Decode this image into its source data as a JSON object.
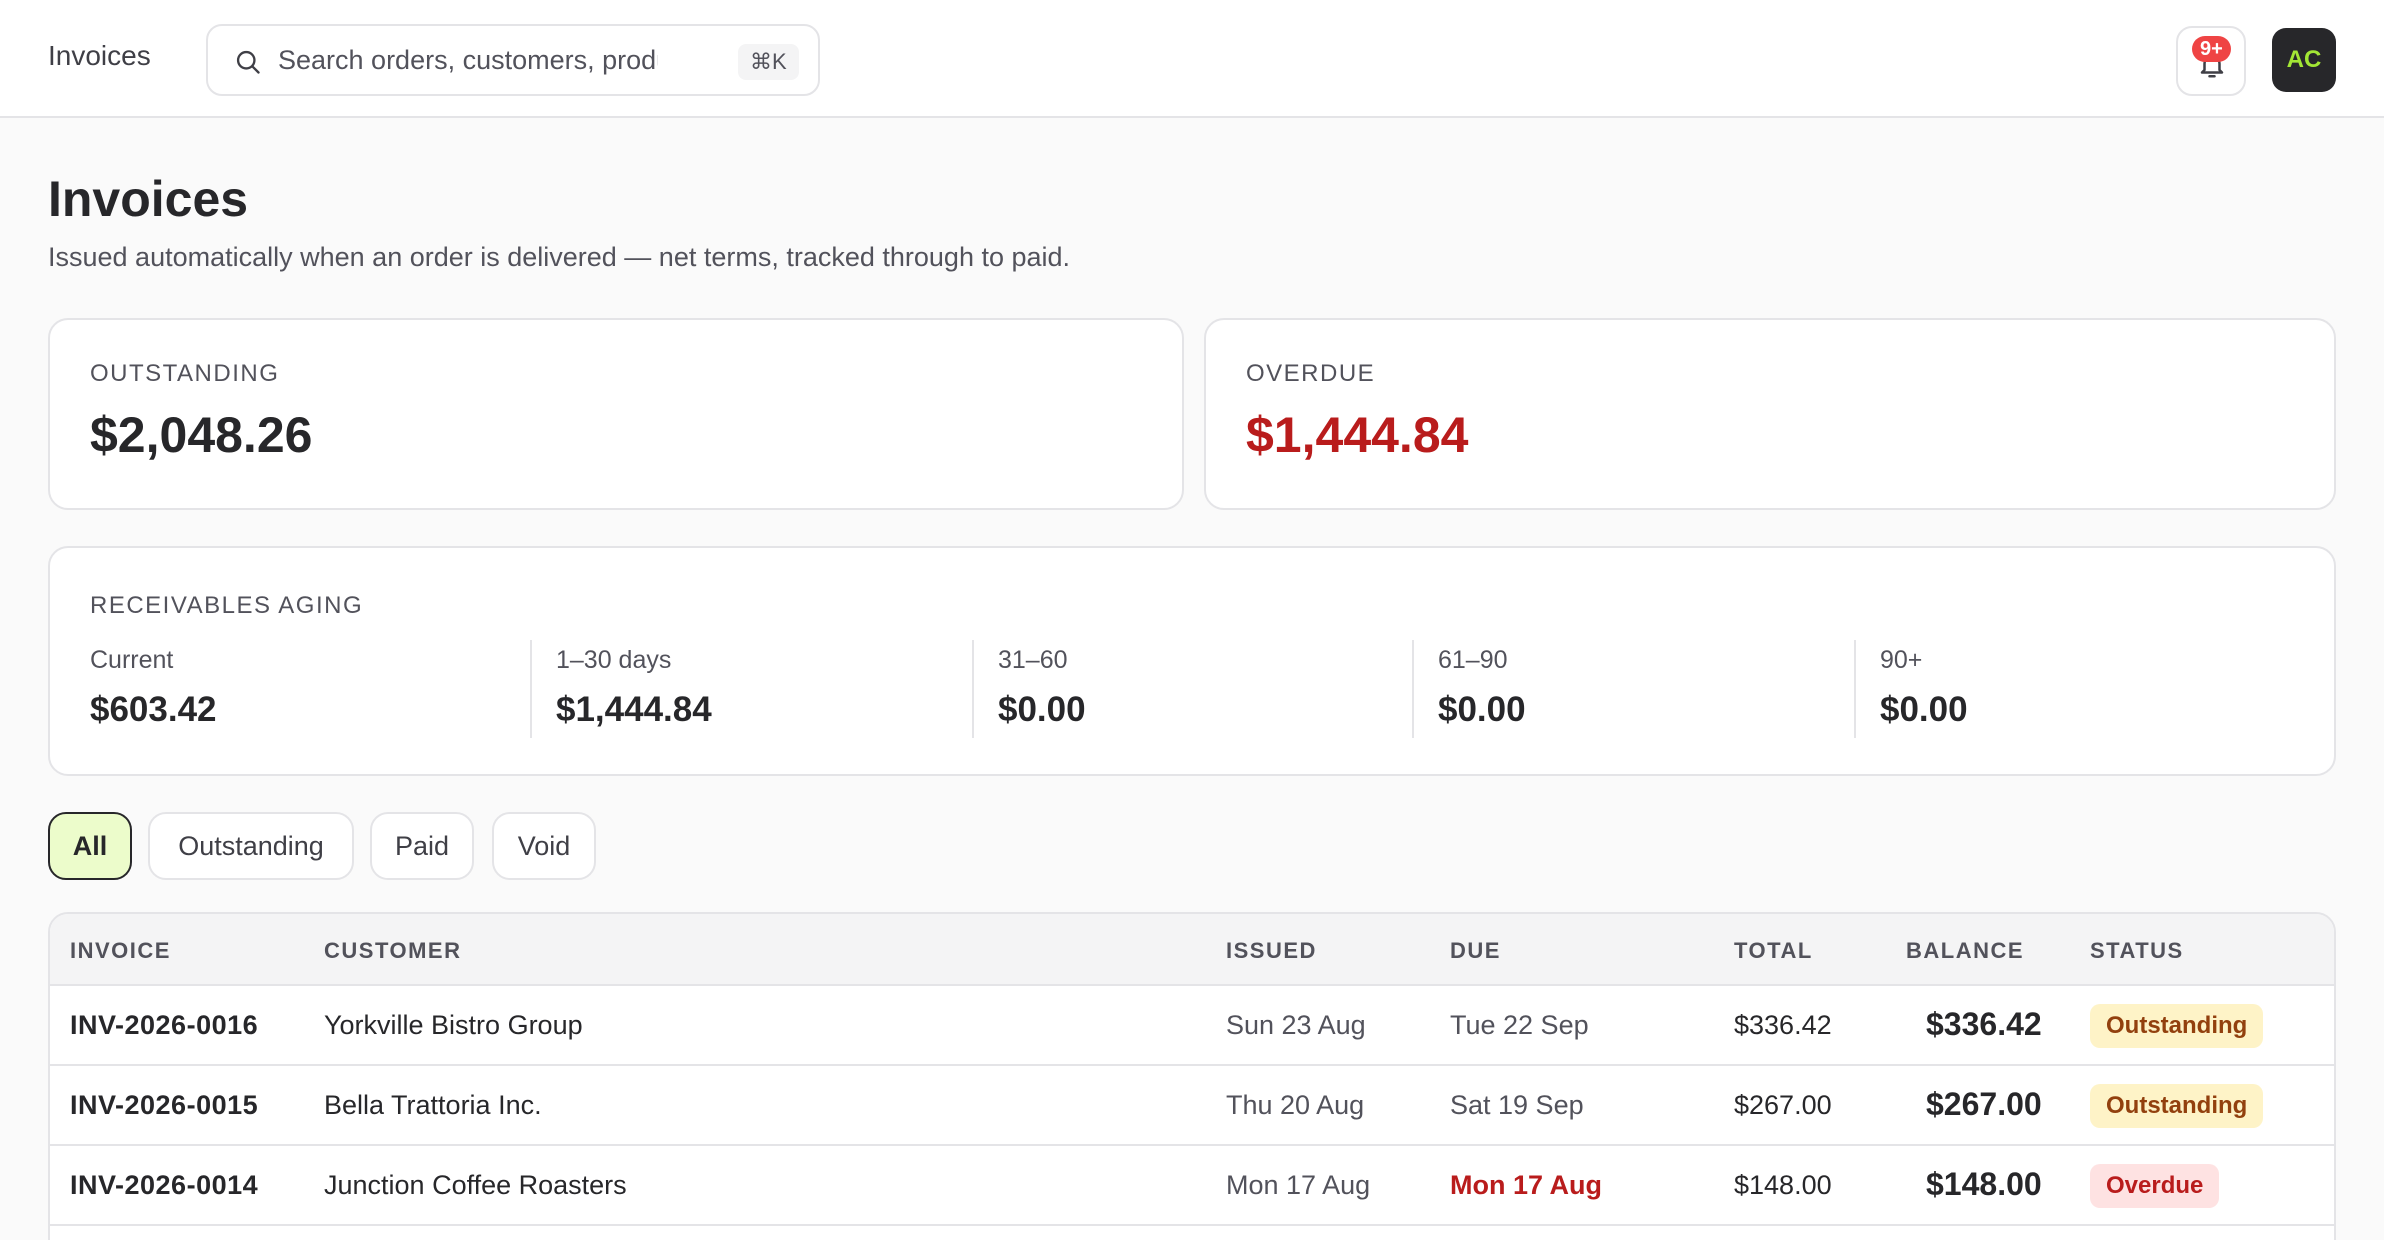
{
  "topbar": {
    "app_title": "Invoices",
    "search_placeholder": "Search orders, customers, products",
    "search_shortcut": "⌘K",
    "notifications_badge": "9+",
    "avatar_initials": "AC"
  },
  "page": {
    "title": "Invoices",
    "subtitle": "Issued automatically when an order is delivered — net terms, tracked through to paid."
  },
  "summary": {
    "outstanding": {
      "label": "OUTSTANDING",
      "amount": "$2,048.26"
    },
    "overdue": {
      "label": "OVERDUE",
      "amount": "$1,444.84"
    }
  },
  "aging": {
    "label": "RECEIVABLES AGING",
    "buckets": [
      {
        "label": "Current",
        "value": "$603.42"
      },
      {
        "label": "1–30 days",
        "value": "$1,444.84"
      },
      {
        "label": "31–60",
        "value": "$0.00"
      },
      {
        "label": "61–90",
        "value": "$0.00"
      },
      {
        "label": "90+",
        "value": "$0.00"
      }
    ]
  },
  "filters": [
    {
      "label": "All",
      "active": true
    },
    {
      "label": "Outstanding",
      "active": false
    },
    {
      "label": "Paid",
      "active": false
    },
    {
      "label": "Void",
      "active": false
    }
  ],
  "table": {
    "columns": [
      "INVOICE",
      "CUSTOMER",
      "ISSUED",
      "DUE",
      "TOTAL",
      "BALANCE",
      "STATUS"
    ],
    "rows": [
      {
        "invoice": "INV-2026-0016",
        "customer": "Yorkville Bistro Group",
        "issued": "Sun 23 Aug",
        "due": "Tue 22 Sep",
        "total": "$336.42",
        "balance": "$336.42",
        "status": "Outstanding"
      },
      {
        "invoice": "INV-2026-0015",
        "customer": "Bella Trattoria Inc.",
        "issued": "Thu 20 Aug",
        "due": "Sat 19 Sep",
        "total": "$267.00",
        "balance": "$267.00",
        "status": "Outstanding"
      },
      {
        "invoice": "INV-2026-0014",
        "customer": "Junction Coffee Roasters",
        "issued": "Mon 17 Aug",
        "due": "Mon 17 Aug",
        "total": "$148.00",
        "balance": "$148.00",
        "status": "Overdue"
      }
    ]
  },
  "colors": {
    "overdue": "#b91c1c",
    "active_chip_bg": "#ecfccb",
    "avatar_bg": "#27272a",
    "avatar_text": "#a3e635",
    "badge": "#ef4444"
  }
}
